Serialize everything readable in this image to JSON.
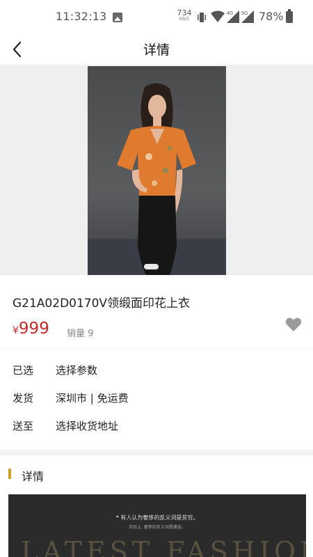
{
  "status_bar": {
    "time": "11:32:13",
    "net_speed_value": "734",
    "net_speed_unit": "KB/S",
    "sim1_label": "4G",
    "sim2_label": "5G",
    "battery": "78%"
  },
  "nav": {
    "title": "详情"
  },
  "product": {
    "title": "G21A02D0170V领缎面印花上衣",
    "currency": "¥",
    "price": "999",
    "sales": "销量 9"
  },
  "options": [
    {
      "label": "已选",
      "value": "选择参数"
    },
    {
      "label": "发货",
      "value": "深圳市 | 免运费"
    },
    {
      "label": "送至",
      "value": "选择收货地址"
    }
  ],
  "detail": {
    "title": "详情",
    "banner_quote": "❝ 有人认为奢侈的反义词是贫穷。",
    "banner_sub": "实际上, 奢侈的反义词是庸俗。",
    "banner_word": "LATEST FASHION"
  },
  "colors": {
    "price": "#c62a2a",
    "accent_marker": "#c9a227"
  }
}
